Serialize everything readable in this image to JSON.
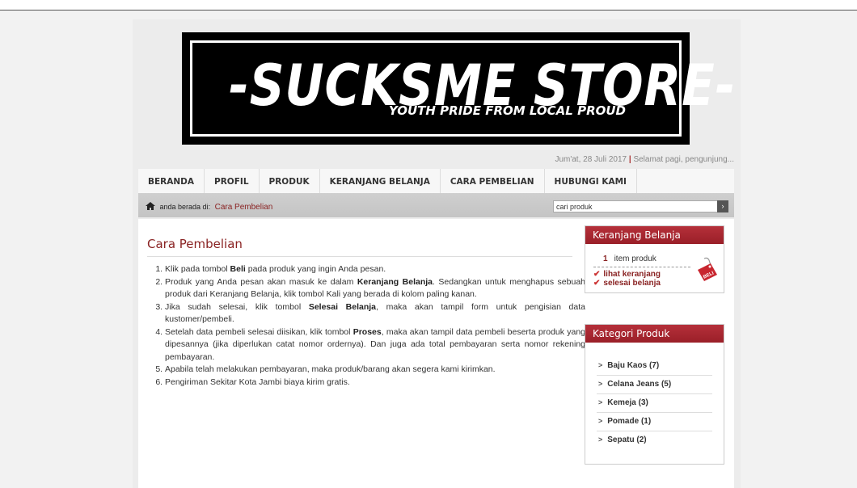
{
  "banner": {
    "title": "-SUCKSME STORE-",
    "tagline": "YOUTH PRIDE FROM LOCAL PROUD"
  },
  "greeting": {
    "date": "Jum'at, 28 Juli 2017",
    "separator": "|",
    "message": "Selamat pagi, pengunjung..."
  },
  "nav": {
    "items": [
      "BERANDA",
      "PROFIL",
      "PRODUK",
      "KERANJANG BELANJA",
      "CARA PEMBELIAN",
      "HUBUNGI KAMI"
    ]
  },
  "breadcrumb": {
    "prefix": "anda berada di:",
    "current": "Cara Pembelian"
  },
  "search": {
    "value": "cari produk",
    "button_glyph": "›"
  },
  "main": {
    "title": "Cara Pembelian",
    "steps": [
      {
        "pre": "Klik pada tombol ",
        "bold": "Beli",
        "post": " pada produk yang ingin Anda pesan."
      },
      {
        "pre": "Produk yang Anda pesan akan masuk ke dalam ",
        "bold": "Keranjang Belanja",
        "post": ". Sedangkan untuk menghapus sebuah produk dari Keranjang Belanja, klik tombol Kali yang berada di kolom paling kanan."
      },
      {
        "pre": "Jika sudah selesai, klik tombol ",
        "bold": "Selesai Belanja",
        "post": ", maka akan tampil form untuk pengisian data kustomer/pembeli."
      },
      {
        "pre": "Setelah data pembeli selesai diisikan, klik tombol ",
        "bold": "Proses",
        "post": ", maka akan tampil data pembeli beserta produk yang dipesannya (jika diperlukan catat nomor ordernya). Dan juga ada total pembayaran serta nomor rekening pembayaran."
      },
      {
        "pre": "Apabila telah melakukan pembayaran, maka produk/barang akan segera kami kirimkan.",
        "bold": "",
        "post": ""
      },
      {
        "pre": "Pengiriman Sekitar Kota Jambi biaya kirim gratis.",
        "bold": "",
        "post": ""
      }
    ]
  },
  "cart": {
    "heading": "Keranjang Belanja",
    "count": "1",
    "count_label": "item produk",
    "link_view": "lihat keranjang",
    "link_finish": "selesai belanja",
    "badge_text": "BELI"
  },
  "categories": {
    "heading": "Kategori Produk",
    "items": [
      "Baju Kaos (7)",
      "Celana Jeans (5)",
      "Kemeja (3)",
      "Pomade (1)",
      "Sepatu (2)"
    ]
  },
  "colors": {
    "accent": "#8a2323",
    "header_red": "#a8262f"
  }
}
